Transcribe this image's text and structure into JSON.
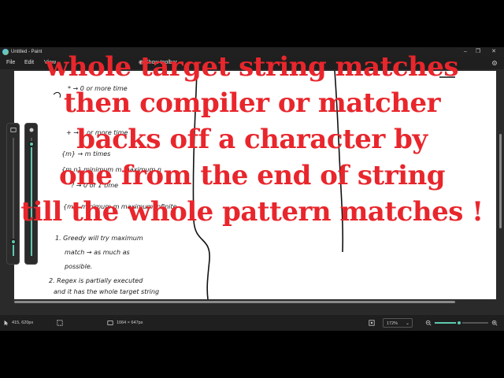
{
  "window": {
    "title": "Untitled - Paint"
  },
  "menu": {
    "items": [
      "File",
      "Edit",
      "View",
      "Show toolbar"
    ]
  },
  "window_controls": {
    "minimize": "–",
    "maximize": "❐",
    "close": "✕"
  },
  "handwriting": {
    "lines": [
      "* → 0 or more time",
      "+ → 1 or more time",
      "{m} → m times",
      "{m,n} minimum m maximum n",
      "? → 0 or 1 time",
      "{m,} minimum m maximum infinite",
      "1. Greedy will try maximum",
      "match → as much as",
      "possible.",
      "2. Regex is partially executed",
      "and it has the whole target string"
    ]
  },
  "overlay": {
    "lines": [
      "whole target string matches",
      "then compiler or matcher",
      "backs off a character by",
      "one from the end of string",
      "till the whole pattern matches !"
    ]
  },
  "status": {
    "cursor_position": "415, 620px",
    "canvas_size": "1064 × 647px",
    "zoom_label": "172%",
    "zoom_level": 0.45
  },
  "sliders": {
    "left_level": 0.12,
    "right_level": 0.95
  },
  "icons": {
    "cursor": "cursor-icon",
    "selection": "selection-icon",
    "canvas_size": "canvas-size-icon",
    "fit": "fit-icon",
    "zoom_out": "zoom-out-icon",
    "zoom_in": "zoom-in-icon",
    "settings": "gear-icon"
  },
  "colors": {
    "overlay_text": "#e8262c",
    "accent": "#5ec9b0",
    "chrome": "#1f1f1f"
  }
}
